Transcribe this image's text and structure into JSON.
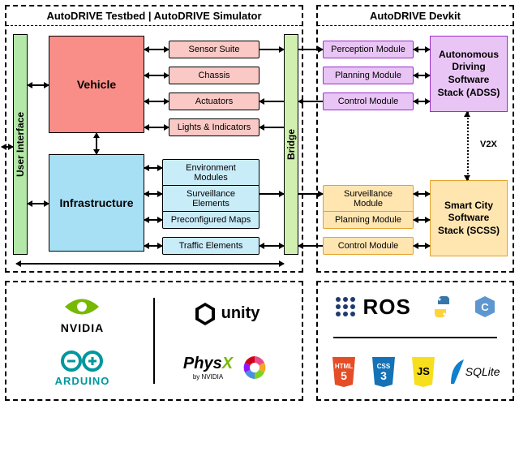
{
  "left_panel": {
    "title": "AutoDRIVE Testbed | AutoDRIVE Simulator",
    "ui_label": "User Interface",
    "bridge_label": "Bridge",
    "vehicle": {
      "label": "Vehicle",
      "items": [
        "Sensor Suite",
        "Chassis",
        "Actuators",
        "Lights & Indicators"
      ]
    },
    "infrastructure": {
      "label": "Infrastructure",
      "items": [
        "Environment Modules",
        "Surveillance Elements",
        "Preconfigured Maps",
        "Traffic Elements"
      ]
    }
  },
  "right_panel": {
    "title": "AutoDRIVE Devkit",
    "adss": {
      "modules": [
        "Perception Module",
        "Planning Module",
        "Control Module"
      ],
      "stack": "Autonomous Driving Software Stack (ADSS)"
    },
    "v2x_label": "V2X",
    "scss": {
      "modules": [
        "Surveillance Module",
        "Planning Module",
        "Control Module"
      ],
      "stack": "Smart City Software Stack (SCSS)"
    }
  },
  "logos_left": {
    "nvidia": "NVIDIA",
    "arduino": "ARDUINO",
    "unity": "unity",
    "physx": "PhysX",
    "physx_sub": "by NVIDIA"
  },
  "logos_right": {
    "ros": "ROS",
    "html5": "HTML",
    "css3": "CSS",
    "js": "JS",
    "sqlite": "SQLite"
  }
}
